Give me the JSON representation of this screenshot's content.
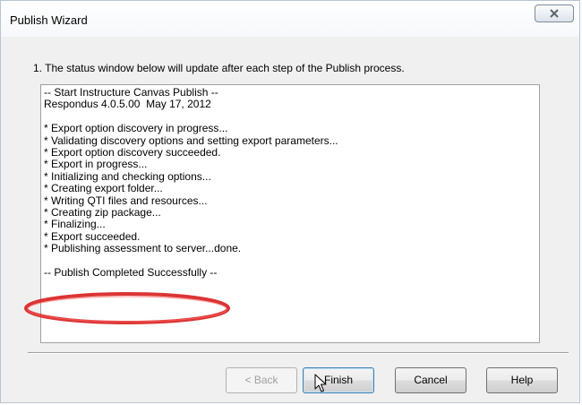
{
  "window": {
    "title": "Publish Wizard"
  },
  "step": {
    "text": "1.  The status window below will update after each step of the Publish process."
  },
  "status_lines": [
    "-- Start Instructure Canvas Publish --",
    "Respondus 4.0.5.00  May 17, 2012",
    "",
    "* Export option discovery in progress...",
    "* Validating discovery options and setting export parameters...",
    "* Export option discovery succeeded.",
    "* Export in progress...",
    "* Initializing and checking options...",
    "* Creating export folder...",
    "* Writing QTI files and resources...",
    "* Creating zip package...",
    "* Finalizing...",
    "* Export succeeded.",
    "* Publishing assessment to server...done.",
    "",
    "-- Publish Completed Successfully --"
  ],
  "buttons": {
    "back": "< Back",
    "finish": "Finish",
    "cancel": "Cancel",
    "help": "Help"
  },
  "colors": {
    "highlight_ellipse": "#d81e1e",
    "window_bg": "#f0f0f0"
  },
  "icons": {
    "close": "close-icon",
    "cursor": "mouse-pointer-icon"
  }
}
